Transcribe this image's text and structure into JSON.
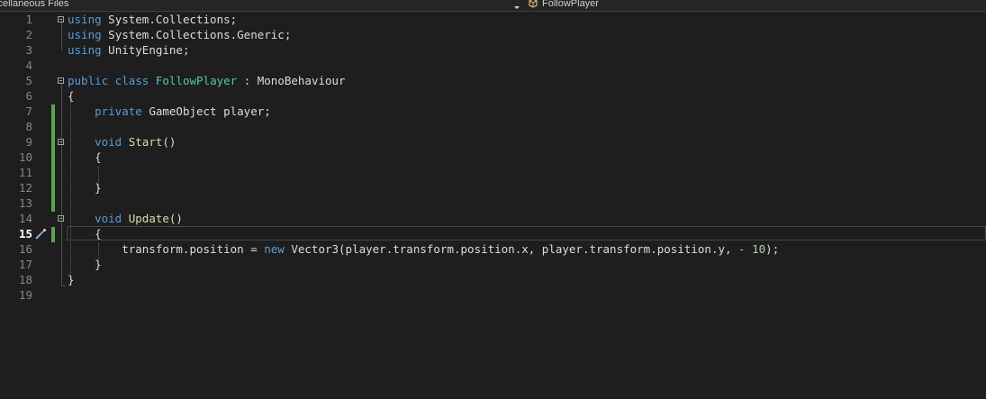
{
  "navbar": {
    "project": "scellaneous Files",
    "member": "FollowPlayer"
  },
  "editor": {
    "current_line": 15,
    "lines": [
      {
        "n": "1"
      },
      {
        "n": "2"
      },
      {
        "n": "3"
      },
      {
        "n": "4"
      },
      {
        "n": "5"
      },
      {
        "n": "6"
      },
      {
        "n": "7"
      },
      {
        "n": "8"
      },
      {
        "n": "9"
      },
      {
        "n": "10"
      },
      {
        "n": "11"
      },
      {
        "n": "12"
      },
      {
        "n": "13"
      },
      {
        "n": "14"
      },
      {
        "n": "15"
      },
      {
        "n": "16"
      },
      {
        "n": "17"
      },
      {
        "n": "18"
      },
      {
        "n": "19"
      }
    ],
    "tokens": {
      "l1": [
        "using",
        " System.Collections;"
      ],
      "l2": [
        "using",
        " System.Collections.Generic;"
      ],
      "l3": [
        "using",
        " UnityEngine;"
      ],
      "l5": [
        "public",
        " ",
        "class",
        " ",
        "FollowPlayer",
        " : MonoBehaviour"
      ],
      "l6": [
        "{"
      ],
      "l7": [
        "    ",
        "private",
        " GameObject player;"
      ],
      "l9": [
        "    ",
        "void",
        " ",
        "Start",
        "()"
      ],
      "l10": [
        "    {"
      ],
      "l12": [
        "    }"
      ],
      "l14": [
        "    ",
        "void",
        " ",
        "Update",
        "()"
      ],
      "l15": [
        "    {"
      ],
      "l16": [
        "        transform.position = ",
        "new",
        " Vector3(player.transform.position.x, player.transform.position.y, ",
        "- ",
        "10",
        ");"
      ],
      "l17": [
        "    }"
      ],
      "l18": [
        "}"
      ]
    }
  },
  "colors": {
    "background": "#1e1e1e",
    "keyword": "#569cd6",
    "type": "#4ec9b0",
    "method": "#dcdcaa",
    "number": "#b5cea8",
    "change_marker": "#57a64a"
  },
  "icons": {
    "quick_action": "screwdriver-brush-icon",
    "member_nav": "class-member-icon"
  }
}
